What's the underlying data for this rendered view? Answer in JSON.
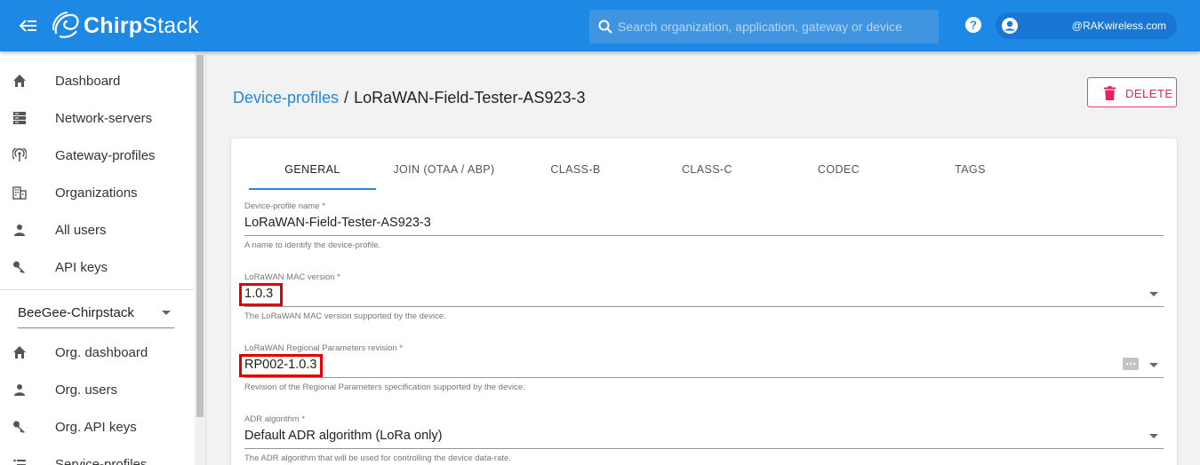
{
  "header": {
    "brand_bold": "Chirp",
    "brand_light": "Stack",
    "search_placeholder": "Search organization, application, gateway or device",
    "username": "@RAKwireless.com",
    "icons": {
      "menu": "menu-collapse-icon",
      "logo": "chirpstack-logo-icon",
      "search": "search-icon",
      "help": "help-icon",
      "user": "account-circle-icon"
    },
    "color": "#1e88e5"
  },
  "sidebar": {
    "items": [
      {
        "label": "Dashboard",
        "icon": "home-icon"
      },
      {
        "label": "Network-servers",
        "icon": "server-icon"
      },
      {
        "label": "Gateway-profiles",
        "icon": "radio-tower-icon"
      },
      {
        "label": "Organizations",
        "icon": "domain-icon"
      },
      {
        "label": "All users",
        "icon": "account-icon"
      },
      {
        "label": "API keys",
        "icon": "key-icon"
      }
    ],
    "org_selector": {
      "value": "BeeGee-Chirpstack"
    },
    "org_items": [
      {
        "label": "Org. dashboard",
        "icon": "home-icon"
      },
      {
        "label": "Org. users",
        "icon": "account-icon"
      },
      {
        "label": "Org. API keys",
        "icon": "key-icon"
      },
      {
        "label": "Service-profiles",
        "icon": "list-icon"
      }
    ]
  },
  "main": {
    "breadcrumb": {
      "link": "Device-profiles",
      "separator": "/",
      "current": "LoRaWAN-Field-Tester-AS923-3"
    },
    "delete_label": "DELETE",
    "delete_color": "#e91e63",
    "tabs": [
      {
        "label": "GENERAL",
        "active": true
      },
      {
        "label": "JOIN (OTAA / ABP)"
      },
      {
        "label": "CLASS-B"
      },
      {
        "label": "CLASS-C"
      },
      {
        "label": "CODEC"
      },
      {
        "label": "TAGS"
      }
    ],
    "fields": [
      {
        "label": "Device-profile name *",
        "value": "LoRaWAN-Field-Tester-AS923-3",
        "help": "A name to identify the device-profile."
      },
      {
        "label": "LoRaWAN MAC version *",
        "value": "1.0.3",
        "help": "The LoRaWAN MAC version supported by the device."
      },
      {
        "label": "LoRaWAN Regional Parameters revision *",
        "value": "RP002-1.0.3",
        "help": "Revision of the Regional Parameters specification supported by the device."
      },
      {
        "label": "ADR algorithm *",
        "value": "Default ADR algorithm (LoRa only)",
        "help": "The ADR algorithm that will be used for controlling the device data-rate."
      }
    ],
    "highlight_color": "#e00000"
  }
}
